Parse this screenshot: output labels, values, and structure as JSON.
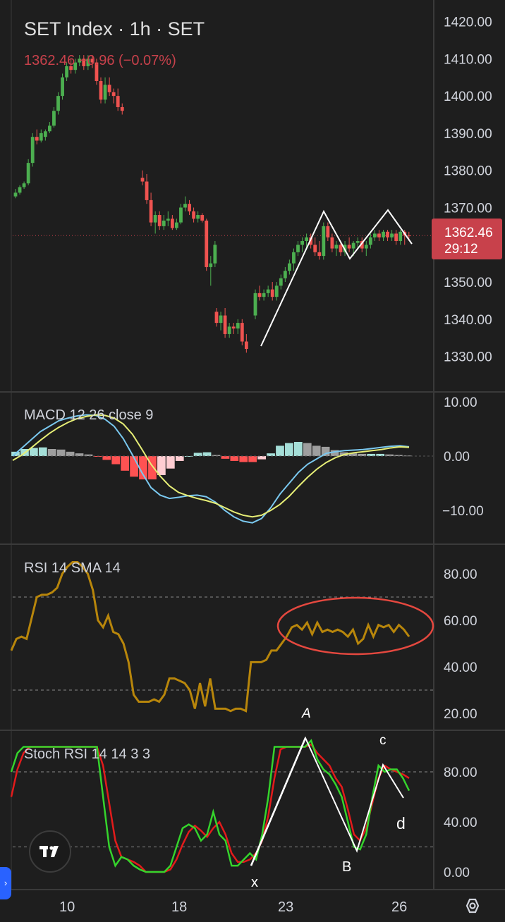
{
  "colors": {
    "background": "#1e1e1e",
    "up": "#4caf50",
    "down": "#ef5350",
    "price_badge": "#c8414b",
    "macd_line": "#7ac8ef",
    "signal_line": "#e6ee76",
    "rsi_line": "#b8860b",
    "stoch_k": "#35d42c",
    "stoch_d": "#e31b1b",
    "annotation": "#ffffff",
    "ellipse": "#e5483f"
  },
  "header": {
    "title": "SET Index · 1h · SET",
    "change": "1362.46 −0.96 (−0.07%)"
  },
  "price_badge": {
    "price": "1362.46",
    "countdown": "29:12"
  },
  "x_axis": {
    "labels": [
      "10",
      "18",
      "23",
      "26"
    ]
  },
  "chart_data": [
    {
      "type": "candlestick",
      "title": "SET Index · 1h · SET",
      "ylim": [
        1325,
        1422
      ],
      "y_ticks": [
        "1420.00",
        "1410.00",
        "1400.00",
        "1390.00",
        "1380.00",
        "1370.00",
        "1350.00",
        "1340.00",
        "1330.00"
      ],
      "last_price": 1362.46,
      "candles": [
        [
          1373,
          1375,
          1372.5,
          1374
        ],
        [
          1374,
          1376,
          1373.5,
          1375.5
        ],
        [
          1375.5,
          1377,
          1375,
          1376.5
        ],
        [
          1376.5,
          1383,
          1376,
          1382
        ],
        [
          1382,
          1390,
          1381,
          1389
        ],
        [
          1389,
          1391,
          1387,
          1388
        ],
        [
          1388,
          1391,
          1387.5,
          1390
        ],
        [
          1389,
          1391,
          1388,
          1390.5
        ],
        [
          1390.5,
          1393,
          1390,
          1392
        ],
        [
          1392,
          1397,
          1391.5,
          1396
        ],
        [
          1396,
          1401,
          1395,
          1400
        ],
        [
          1400,
          1406,
          1399,
          1405
        ],
        [
          1405,
          1409,
          1404,
          1408
        ],
        [
          1408,
          1410,
          1406,
          1407
        ],
        [
          1407,
          1410,
          1406,
          1409
        ],
        [
          1409,
          1411,
          1408,
          1410
        ],
        [
          1410,
          1411,
          1407,
          1408
        ],
        [
          1408,
          1411,
          1407,
          1410
        ],
        [
          1410,
          1411,
          1407.5,
          1409
        ],
        [
          1409,
          1410,
          1403,
          1404
        ],
        [
          1404,
          1405,
          1398,
          1399
        ],
        [
          1399,
          1405,
          1398,
          1403
        ],
        [
          1403,
          1405,
          1400,
          1401
        ],
        [
          1401,
          1402,
          1398,
          1400
        ],
        [
          1400,
          1402,
          1396,
          1397
        ],
        [
          1397,
          1398,
          1395,
          1396
        ],
        [
          1378,
          1380,
          1376,
          1377
        ],
        [
          1377,
          1379,
          1371,
          1372
        ],
        [
          1372,
          1374,
          1365,
          1366
        ],
        [
          1366,
          1369,
          1363,
          1368
        ],
        [
          1368,
          1369,
          1364,
          1365
        ],
        [
          1365,
          1368,
          1364,
          1366.5
        ],
        [
          1366.5,
          1369,
          1365,
          1367
        ],
        [
          1367,
          1368,
          1364,
          1364.5
        ],
        [
          1364.5,
          1367,
          1364,
          1366
        ],
        [
          1366,
          1371,
          1365.5,
          1370
        ],
        [
          1370,
          1373,
          1369,
          1371
        ],
        [
          1371,
          1372,
          1368,
          1369
        ],
        [
          1369,
          1370,
          1366,
          1367
        ],
        [
          1367,
          1369,
          1366,
          1368
        ],
        [
          1368,
          1368.5,
          1366,
          1366.5
        ],
        [
          1366.5,
          1367,
          1353,
          1354
        ],
        [
          1354,
          1357,
          1349,
          1355
        ],
        [
          1355,
          1361,
          1354,
          1360
        ],
        [
          1342,
          1343,
          1338,
          1339
        ],
        [
          1339,
          1342,
          1337,
          1341
        ],
        [
          1341,
          1343,
          1335,
          1336
        ],
        [
          1336,
          1339,
          1335,
          1338
        ],
        [
          1338,
          1339,
          1336,
          1337.5
        ],
        [
          1337.5,
          1340,
          1336,
          1339
        ],
        [
          1339,
          1340,
          1333,
          1334
        ],
        [
          1334,
          1336,
          1331,
          1332
        ],
        [
          1341,
          1348,
          1340,
          1347
        ],
        [
          1347,
          1349,
          1345,
          1346
        ],
        [
          1346,
          1348,
          1345,
          1347
        ],
        [
          1347,
          1349,
          1346,
          1348
        ],
        [
          1348,
          1350,
          1345,
          1346
        ],
        [
          1346,
          1350,
          1345,
          1349
        ],
        [
          1349,
          1352,
          1348,
          1351
        ],
        [
          1351,
          1354,
          1350,
          1353
        ],
        [
          1353,
          1356,
          1352,
          1355
        ],
        [
          1355,
          1359,
          1353,
          1358
        ],
        [
          1358,
          1361,
          1357,
          1360
        ],
        [
          1360,
          1362,
          1358,
          1361
        ],
        [
          1361,
          1363,
          1359,
          1362
        ],
        [
          1362,
          1363,
          1359,
          1360
        ],
        [
          1360,
          1362,
          1357,
          1358
        ],
        [
          1358,
          1361,
          1356,
          1357
        ],
        [
          1357,
          1366,
          1356,
          1365
        ],
        [
          1365,
          1366,
          1361,
          1362
        ],
        [
          1362,
          1363,
          1358,
          1359
        ],
        [
          1359,
          1361,
          1357,
          1360
        ],
        [
          1360,
          1361,
          1357,
          1358
        ],
        [
          1358,
          1361,
          1357,
          1360
        ],
        [
          1360,
          1362,
          1358,
          1359
        ],
        [
          1359,
          1361,
          1357,
          1360.5
        ],
        [
          1360.5,
          1362,
          1359,
          1361
        ],
        [
          1361,
          1362,
          1358,
          1359
        ],
        [
          1359,
          1361,
          1357,
          1360
        ],
        [
          1360,
          1363,
          1359,
          1362
        ],
        [
          1362,
          1364,
          1361,
          1363
        ],
        [
          1363,
          1364,
          1361,
          1362
        ],
        [
          1362,
          1364,
          1361,
          1363.5
        ],
        [
          1363.5,
          1364,
          1361,
          1362
        ],
        [
          1362,
          1364,
          1361,
          1363
        ],
        [
          1363,
          1364,
          1360,
          1361
        ],
        [
          1361,
          1364,
          1360,
          1363.5
        ],
        [
          1363.5,
          1364,
          1360,
          1362.5
        ],
        [
          1362.5,
          1363.5,
          1361,
          1362.46
        ]
      ],
      "pattern": {
        "x": [
          1332,
          1367
        ],
        "A": [
          1355,
          1367
        ],
        "B": [
          1356.5,
          1367
        ],
        "c_d": [
          1363,
          1359
        ]
      }
    },
    {
      "type": "line",
      "title": "MACD 12 26 close 9",
      "ylim": [
        -13,
        12
      ],
      "y_ticks": [
        "10.00",
        "0.00",
        "−10.00"
      ],
      "series": [
        {
          "name": "MACD",
          "values": [
            0.0,
            1.5,
            3.0,
            4.5,
            5.5,
            6.5,
            7.0,
            7.4,
            7.6,
            7.5,
            6.8,
            5.5,
            3.2,
            0.2,
            -3.0,
            -5.8,
            -7.2,
            -7.8,
            -7.6,
            -7.3,
            -7.2,
            -7.5,
            -8.5,
            -10.0,
            -11.2,
            -12.0,
            -12.3,
            -11.5,
            -9.5,
            -7.0,
            -5.0,
            -3.0,
            -1.5,
            -0.5,
            0.5,
            0.8,
            1.0,
            1.1,
            1.2,
            1.4,
            1.6,
            1.8,
            1.9,
            1.7
          ]
        },
        {
          "name": "Signal",
          "values": [
            -0.8,
            0.2,
            1.5,
            2.9,
            4.2,
            5.3,
            6.2,
            6.9,
            7.3,
            7.6,
            7.5,
            7.0,
            5.9,
            4.0,
            1.3,
            -1.5,
            -3.7,
            -5.5,
            -6.7,
            -7.3,
            -7.8,
            -8.2,
            -8.7,
            -9.5,
            -10.3,
            -10.9,
            -11.2,
            -10.9,
            -10.0,
            -8.9,
            -7.4,
            -5.6,
            -3.9,
            -2.4,
            -1.2,
            -0.3,
            0.3,
            0.6,
            0.8,
            1.0,
            1.2,
            1.5,
            1.7,
            1.6
          ]
        },
        {
          "name": "Histogram",
          "values": [
            0.8,
            1.3,
            1.5,
            1.6,
            1.3,
            1.2,
            0.8,
            0.5,
            0.3,
            -0.1,
            -0.7,
            -1.5,
            -2.7,
            -3.8,
            -4.3,
            -4.3,
            -3.5,
            -2.3,
            -0.9,
            0.0,
            0.6,
            0.7,
            0.2,
            -0.5,
            -0.9,
            -1.1,
            -1.1,
            -0.6,
            0.5,
            1.9,
            2.4,
            2.6,
            2.4,
            1.9,
            1.7,
            1.1,
            0.7,
            0.5,
            0.4,
            0.4,
            0.4,
            0.3,
            0.2,
            0.1
          ]
        }
      ]
    },
    {
      "type": "line",
      "title": "RSI 14 SMA 14",
      "ylim": [
        15,
        90
      ],
      "y_ticks": [
        "80.00",
        "60.00",
        "40.00",
        "20.00"
      ],
      "bands": [
        70,
        30
      ],
      "series": [
        {
          "name": "RSI",
          "values": [
            47,
            52,
            53,
            52,
            61,
            70,
            71,
            71,
            72,
            74,
            80,
            83,
            85,
            85,
            83,
            80,
            73,
            60,
            57,
            62,
            55,
            54,
            50,
            42,
            28,
            25,
            25,
            25,
            26,
            25,
            28,
            35,
            35,
            34,
            33,
            30,
            22,
            33,
            23,
            35,
            22,
            22,
            22,
            21,
            22,
            22,
            21,
            42,
            42,
            42,
            43,
            47,
            47,
            50,
            53,
            57,
            58,
            56,
            59,
            54,
            59,
            55,
            56,
            55,
            56,
            55,
            53,
            56,
            50,
            52,
            58,
            53,
            58,
            57,
            58,
            55,
            58,
            56,
            53
          ]
        }
      ]
    },
    {
      "type": "line",
      "title": "Stoch RSI 14 14 3 3",
      "ylim": [
        -5,
        110
      ],
      "y_ticks": [
        "80.00",
        "40.00",
        "0.00"
      ],
      "bands": [
        80,
        20
      ],
      "series": [
        {
          "name": "K",
          "values": [
            80,
            95,
            100,
            100,
            100,
            100,
            100,
            100,
            100,
            100,
            100,
            100,
            100,
            100,
            100,
            60,
            20,
            5,
            12,
            10,
            5,
            2,
            0,
            0,
            0,
            0,
            5,
            20,
            35,
            38,
            35,
            25,
            30,
            48,
            30,
            25,
            5,
            5,
            10,
            15,
            10,
            30,
            60,
            100,
            100,
            100,
            100,
            100,
            100,
            105,
            90,
            82,
            78,
            70,
            60,
            40,
            20,
            18,
            30,
            60,
            85,
            80,
            82,
            82,
            75,
            65
          ]
        },
        {
          "name": "D",
          "values": [
            60,
            82,
            95,
            100,
            100,
            100,
            100,
            100,
            100,
            100,
            100,
            100,
            100,
            100,
            100,
            85,
            55,
            25,
            12,
            10,
            8,
            5,
            0,
            0,
            0,
            0,
            2,
            10,
            22,
            32,
            37,
            33,
            28,
            35,
            40,
            30,
            15,
            8,
            8,
            10,
            15,
            25,
            45,
            75,
            98,
            100,
            100,
            100,
            100,
            102,
            95,
            90,
            85,
            75,
            68,
            50,
            30,
            25,
            35,
            55,
            75,
            85,
            82,
            80,
            78,
            75
          ]
        }
      ],
      "annotation_labels": {
        "A": "A",
        "B": "B",
        "c": "c",
        "d": "d",
        "x": "x"
      }
    }
  ]
}
